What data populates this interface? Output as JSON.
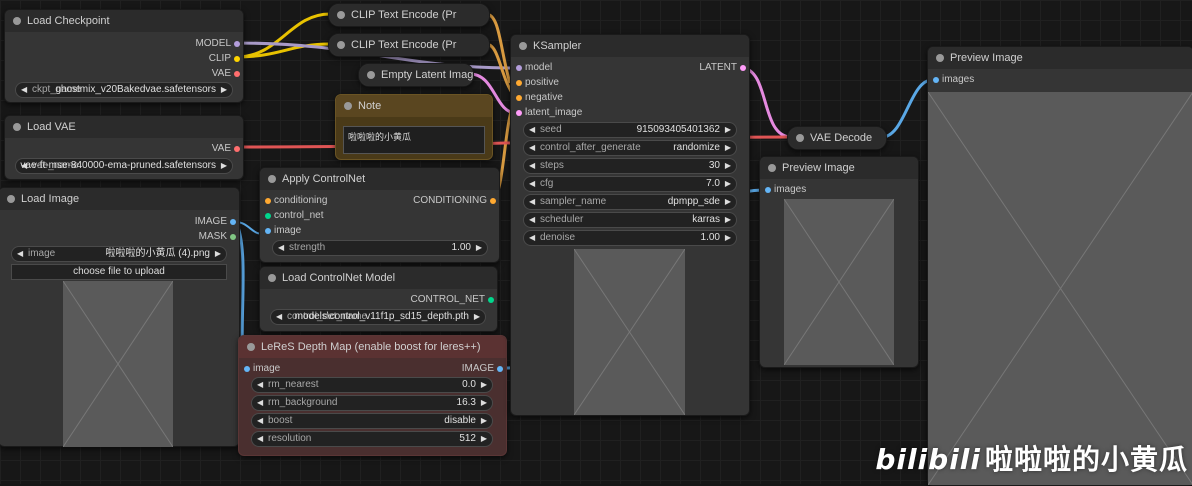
{
  "nodes": {
    "load_checkpoint": {
      "title": "Load Checkpoint",
      "outputs": [
        "MODEL",
        "CLIP",
        "VAE"
      ],
      "widget": {
        "label": "ckpt_name",
        "value": "ghostmix_v20Bakedvae.safetensors"
      }
    },
    "load_vae": {
      "title": "Load VAE",
      "outputs": [
        "VAE"
      ],
      "widget": {
        "label": "vae_name",
        "value": "vae-ft-mse-840000-ema-pruned.safetensors"
      }
    },
    "load_image": {
      "title": "Load Image",
      "outputs": [
        "IMAGE",
        "MASK"
      ],
      "widget": {
        "label": "image",
        "value": "啦啦啦的小黄瓜 (4).png"
      },
      "upload_button": "choose file to upload"
    },
    "clip_text_encode_1": {
      "title": "CLIP Text Encode (Pr"
    },
    "clip_text_encode_2": {
      "title": "CLIP Text Encode (Pr"
    },
    "empty_latent": {
      "title": "Empty Latent Image"
    },
    "note": {
      "title": "Note",
      "text": "啦啦啦的小黄瓜"
    },
    "apply_controlnet": {
      "title": "Apply ControlNet",
      "inputs": [
        "conditioning",
        "control_net",
        "image"
      ],
      "outputs": [
        "CONDITIONING"
      ],
      "widget": {
        "label": "strength",
        "value": "1.00"
      }
    },
    "load_controlnet": {
      "title": "Load ControlNet Model",
      "outputs": [
        "CONTROL_NET"
      ],
      "widget": {
        "label": "control_net_name",
        "value": "models\\control_v11f1p_sd15_depth.pth"
      }
    },
    "leres": {
      "title": "LeReS Depth Map (enable boost for leres++)",
      "inputs": [
        "image"
      ],
      "outputs": [
        "IMAGE"
      ],
      "widgets": [
        {
          "label": "rm_nearest",
          "value": "0.0"
        },
        {
          "label": "rm_background",
          "value": "16.3"
        },
        {
          "label": "boost",
          "value": "disable"
        },
        {
          "label": "resolution",
          "value": "512"
        }
      ]
    },
    "ksampler": {
      "title": "KSampler",
      "inputs": [
        "model",
        "positive",
        "negative",
        "latent_image"
      ],
      "outputs": [
        "LATENT"
      ],
      "widgets": [
        {
          "label": "seed",
          "value": "915093405401362"
        },
        {
          "label": "control_after_generate",
          "value": "randomize"
        },
        {
          "label": "steps",
          "value": "30"
        },
        {
          "label": "cfg",
          "value": "7.0"
        },
        {
          "label": "sampler_name",
          "value": "dpmpp_sde"
        },
        {
          "label": "scheduler",
          "value": "karras"
        },
        {
          "label": "denoise",
          "value": "1.00"
        }
      ]
    },
    "vae_decode": {
      "title": "VAE Decode"
    },
    "preview_depth": {
      "title": "Preview Image",
      "inputs": [
        "images"
      ]
    },
    "preview_final": {
      "title": "Preview Image",
      "inputs": [
        "images"
      ]
    }
  },
  "watermark": {
    "logo": "bilibili",
    "text": "啦啦啦的小黄瓜"
  },
  "colors": {
    "model": "#b39ddb",
    "clip": "#ffd500",
    "vae": "#ff6e6e",
    "image": "#64b5f6",
    "mask": "#81c784",
    "latent": "#ff9cf9",
    "conditioning": "#ffa931",
    "control_net": "#00d78d"
  }
}
